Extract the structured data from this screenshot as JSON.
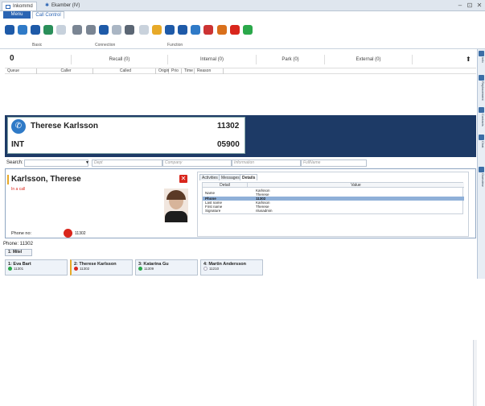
{
  "titlebar": {
    "tabs": [
      {
        "label": "Inkommd"
      },
      {
        "label": "Ekamber (IV)"
      }
    ],
    "minimize": "–",
    "restore": "⊡",
    "close": "✕"
  },
  "ribbon": {
    "tabs": [
      {
        "label": "Menu"
      },
      {
        "label": "Call Control"
      }
    ],
    "groups": [
      {
        "label": "Basic"
      },
      {
        "label": "Connection"
      },
      {
        "label": "Function"
      }
    ]
  },
  "sidebar": {
    "tabs": [
      {
        "label": "Info"
      },
      {
        "label": "Replacement"
      },
      {
        "label": "Contacts"
      },
      {
        "label": "Chat"
      },
      {
        "label": "Overview"
      }
    ]
  },
  "stats": {
    "count": "0",
    "recall": "Recall (0)",
    "internal": "Internal (0)",
    "park": "Park (0)",
    "external": "External (0)"
  },
  "queue_columns": [
    "Queue",
    "Caller",
    "Called",
    "Origin",
    "Prio",
    "Time",
    "Reason"
  ],
  "call": {
    "name": "Therese Karlsson",
    "number": "11302",
    "type": "INT",
    "dest": "05900"
  },
  "search": {
    "label": "Search:",
    "placeholders": [
      "Dept",
      "Company",
      "Information",
      "FullName"
    ]
  },
  "contact": {
    "name": "Karlsson, Therese",
    "status": "In a call",
    "phone_label": "Phone no:",
    "phone_value": "11302"
  },
  "detail_tabs": [
    {
      "label": "Activities"
    },
    {
      "label": "Messages"
    },
    {
      "label": "Details"
    }
  ],
  "details_table": {
    "headers": [
      "Detail",
      "Value"
    ],
    "rows": [
      {
        "key": "Name",
        "value": "Karlsson\nTherese"
      },
      {
        "key": "Phone",
        "value": "11302"
      },
      {
        "key": "Last name",
        "value": "Karlsson"
      },
      {
        "key": "First name",
        "value": "Therese"
      },
      {
        "key": "Signature",
        "value": "nlusadmin"
      }
    ]
  },
  "phone_footer": "Phone: 11302",
  "group_tab": "1: Mitel",
  "extensions": [
    {
      "name": "1: Eva Bart",
      "num": "11301",
      "color": "#2aa84a"
    },
    {
      "name": "2: Therese Karlsson",
      "num": "11302",
      "color": "#d9261c"
    },
    {
      "name": "3: Katarina Gu",
      "num": "11309",
      "color": "#2aa84a"
    },
    {
      "name": "4: Martin Andersson",
      "num": "11210",
      "color": "#bfc6ce"
    }
  ],
  "colors": {
    "accent": "#1d3a66",
    "tab_active": "#2a64b3",
    "busy": "#d9261c",
    "free": "#2aa84a"
  }
}
